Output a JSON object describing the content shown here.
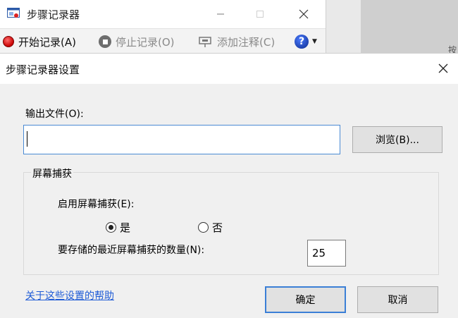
{
  "psr": {
    "title": "步骤记录器",
    "toolbar": {
      "start": "开始记录(A)",
      "stop": "停止记录(O)",
      "comment": "添加注释(C)",
      "help": "?"
    }
  },
  "background": {
    "partial_char": "按"
  },
  "dialog": {
    "title": "步骤记录器设置",
    "output_label": "输出文件(O):",
    "output_value": "",
    "browse_label": "浏览(B)...",
    "group_title": "屏幕捕获",
    "enable_label": "启用屏幕捕获(E):",
    "radio_yes": "是",
    "radio_no": "否",
    "radio_selected": "是",
    "count_label": "要存储的最近屏幕捕获的数量(N):",
    "count_value": "25",
    "help_link": "关于这些设置的帮助",
    "ok_label": "确定",
    "cancel_label": "取消"
  },
  "colors": {
    "accent": "#3b7fd6",
    "link": "#1e5bd6",
    "record_red": "#c80000"
  },
  "icons": {
    "app": "steps-recorder-icon",
    "start": "record-icon",
    "stop": "stop-icon",
    "comment": "add-comment-icon",
    "help": "help-icon"
  }
}
